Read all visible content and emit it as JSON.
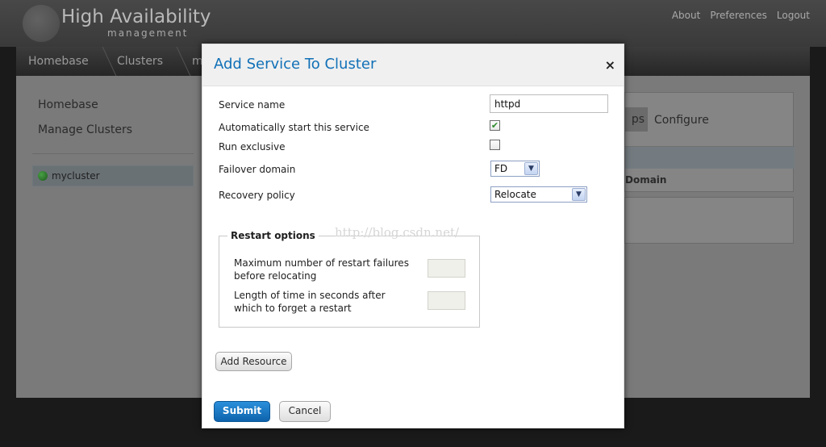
{
  "app": {
    "title": "High Availability",
    "subtitle": "management",
    "top_links": [
      "About",
      "Preferences",
      "Logout"
    ]
  },
  "breadcrumb": [
    "Homebase",
    "Clusters",
    "m"
  ],
  "sidebar": {
    "links": [
      "Homebase",
      "Manage Clusters"
    ],
    "clusters": [
      {
        "name": "mycluster",
        "status_color": "#2e8b2b"
      }
    ]
  },
  "background_panel": {
    "tabs": [
      "ps",
      "Configure"
    ],
    "column_header": "Domain"
  },
  "modal": {
    "title": "Add Service To Cluster",
    "close_label": "×",
    "fields": {
      "service_name_label": "Service name",
      "service_name_value": "httpd",
      "autostart_label": "Automatically start this service",
      "autostart_checked": true,
      "run_exclusive_label": "Run exclusive",
      "run_exclusive_checked": false,
      "failover_domain_label": "Failover domain",
      "failover_domain_value": "FD",
      "recovery_policy_label": "Recovery policy",
      "recovery_policy_value": "Relocate"
    },
    "restart_options": {
      "legend": "Restart options",
      "max_failures_label": "Maximum number of restart failures before relocating",
      "max_failures_value": "",
      "expire_time_label": "Length of time in seconds after which to forget a restart",
      "expire_time_value": ""
    },
    "add_resource_label": "Add Resource",
    "submit_label": "Submit",
    "cancel_label": "Cancel"
  },
  "watermark": "http://blog.csdn.net/",
  "icons": {
    "checkbox_check": "check-icon",
    "select_arrow": "chevron-down-icon",
    "status_dot": "status-dot-icon",
    "close": "close-icon"
  }
}
